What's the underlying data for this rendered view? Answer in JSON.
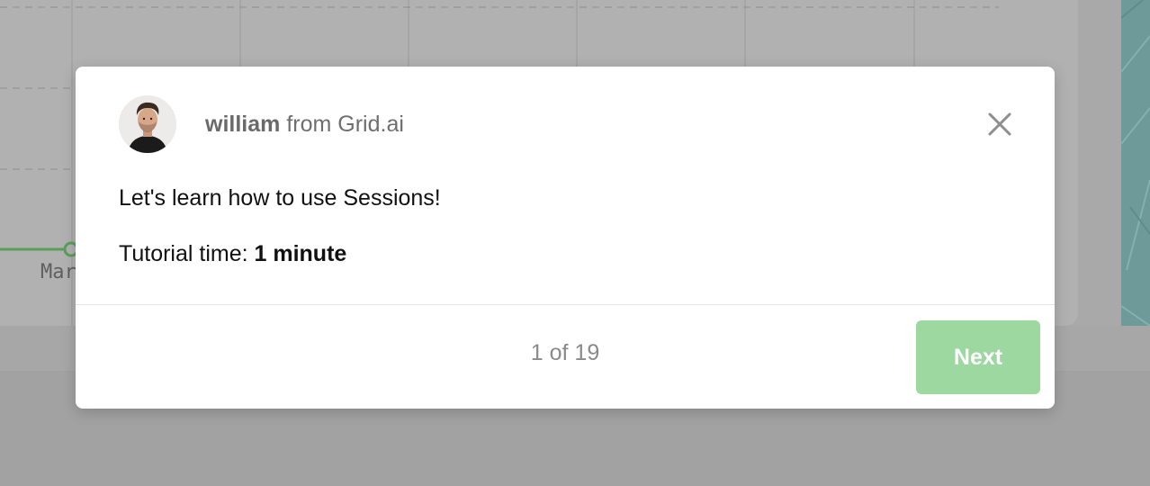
{
  "background": {
    "axis_label_partial": "Mar"
  },
  "tour": {
    "sender": {
      "name": "william",
      "org_text": "from Grid.ai"
    },
    "message": "Let's learn how to use Sessions!",
    "time_label": "Tutorial time:",
    "time_value": "1 minute",
    "progress": {
      "text": "1 of 19",
      "current": 1,
      "total": 19
    },
    "next_label": "Next",
    "close_icon": "close-icon"
  },
  "colors": {
    "next_button": "#9dd8a0",
    "overlay_background": "#a9a9a9",
    "chart_line": "#5aa05a"
  }
}
